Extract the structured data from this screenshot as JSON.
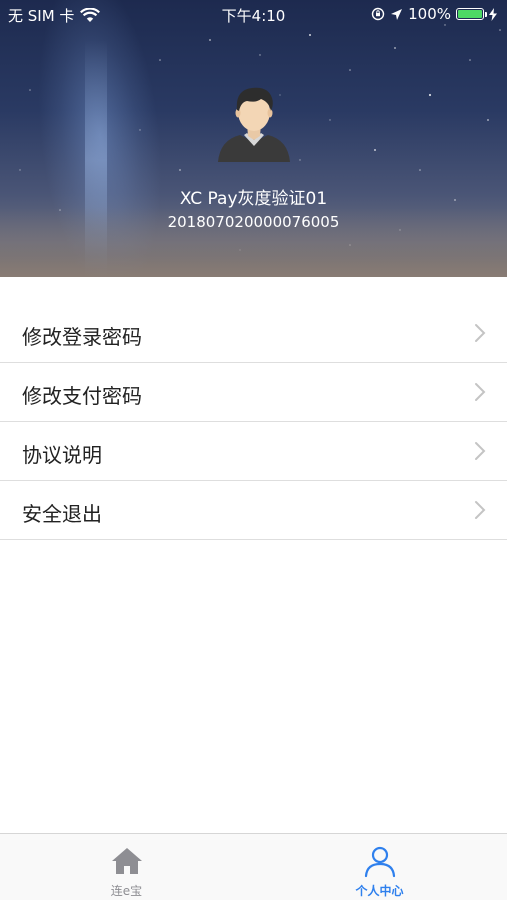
{
  "status_bar": {
    "carrier": "无 SIM 卡",
    "time": "下午4:10",
    "battery_percent": "100%",
    "battery_level": 1.0,
    "icons": [
      "wifi-icon",
      "orientation-lock-icon",
      "location-arrow-icon",
      "battery-icon",
      "charging-bolt-icon"
    ]
  },
  "profile": {
    "name": "XC Pay灰度验证01",
    "id": "201807020000076005",
    "avatar_icon": "user-avatar-icon"
  },
  "menu": {
    "items": [
      {
        "label": "修改登录密码",
        "icon": "chevron-right-icon"
      },
      {
        "label": "修改支付密码",
        "icon": "chevron-right-icon"
      },
      {
        "label": "协议说明",
        "icon": "chevron-right-icon"
      },
      {
        "label": "安全退出",
        "icon": "chevron-right-icon"
      }
    ]
  },
  "tabbar": {
    "tabs": [
      {
        "label": "连e宝",
        "icon": "home-icon",
        "active": false
      },
      {
        "label": "个人中心",
        "icon": "person-icon",
        "active": true
      }
    ]
  },
  "colors": {
    "accent": "#2f80ed",
    "tab_inactive": "#8e8e93",
    "battery_green": "#4cd964",
    "text_primary": "#222222",
    "divider": "#dedede"
  }
}
